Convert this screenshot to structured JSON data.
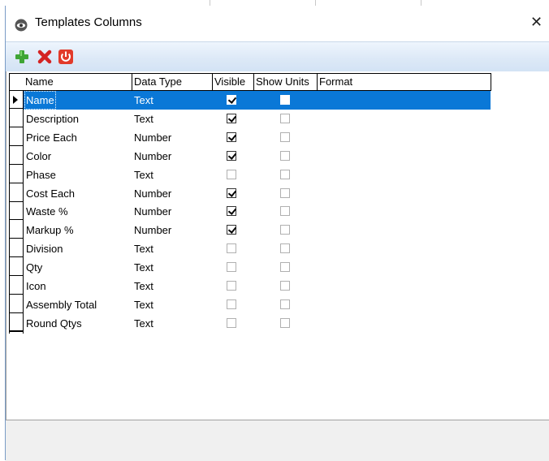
{
  "window": {
    "title": "Templates Columns",
    "close_label": "✕"
  },
  "toolbar": {
    "add_icon": "plus-icon",
    "delete_icon": "x-delete-icon",
    "power_icon": "power-icon",
    "colors": {
      "add": "#3fa535",
      "delete": "#d42323",
      "power": "#e23a2a",
      "background": "#dce8f6"
    }
  },
  "grid": {
    "columns": [
      "Name",
      "Data Type",
      "Visible",
      "Show Units",
      "Format"
    ],
    "selected_row_color": "#0a78d7",
    "rows": [
      {
        "name": "Name",
        "type": "Text",
        "visible": true,
        "show_units": false,
        "selected": true
      },
      {
        "name": "Description",
        "type": "Text",
        "visible": true,
        "show_units": false
      },
      {
        "name": "Price Each",
        "type": "Number",
        "visible": true,
        "show_units": false
      },
      {
        "name": "Color",
        "type": "Number",
        "visible": true,
        "show_units": false
      },
      {
        "name": "Phase",
        "type": "Text",
        "visible": false,
        "show_units": false
      },
      {
        "name": "Cost Each",
        "type": "Number",
        "visible": true,
        "show_units": false
      },
      {
        "name": "Waste %",
        "type": "Number",
        "visible": true,
        "show_units": false
      },
      {
        "name": "Markup %",
        "type": "Number",
        "visible": true,
        "show_units": false
      },
      {
        "name": "Division",
        "type": "Text",
        "visible": false,
        "show_units": false
      },
      {
        "name": "Qty",
        "type": "Text",
        "visible": false,
        "show_units": false
      },
      {
        "name": "Icon",
        "type": "Text",
        "visible": false,
        "show_units": false
      },
      {
        "name": "Assembly Total",
        "type": "Text",
        "visible": false,
        "show_units": false
      },
      {
        "name": "Round Qtys",
        "type": "Text",
        "visible": false,
        "show_units": false
      }
    ]
  }
}
